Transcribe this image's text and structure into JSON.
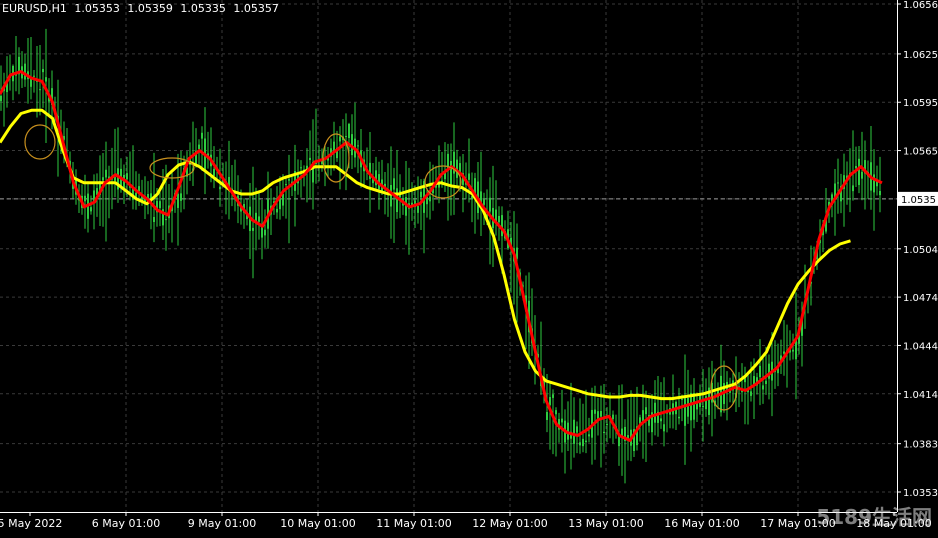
{
  "header": {
    "symbol": "EURUSD,H1",
    "open": "1.05353",
    "high": "1.05359",
    "low": "1.05335",
    "close": "1.05357"
  },
  "watermark": "5189生活网",
  "colors": {
    "background": "#000000",
    "grid": "#3a3a3a",
    "candle": "#2ecc40",
    "ma_fast": "#ff0000",
    "ma_slow": "#ffff00",
    "circle": "#c8901e",
    "axis_text": "#ffffff",
    "price_tag_bg": "#ffffff",
    "price_tag_text": "#000000"
  },
  "chart_data": {
    "type": "line",
    "title": "EURUSD,H1",
    "y_ticks": [
      "1.0656",
      "1.0625",
      "1.0595",
      "1.0565",
      "1.0535",
      "1.0504",
      "1.0474",
      "1.0444",
      "1.0414",
      "1.0383",
      "1.0353"
    ],
    "ylim": [
      1.0347,
      1.066
    ],
    "x_ticks": [
      "5 May 2022",
      "6 May 01:00",
      "9 May 01:00",
      "10 May 01:00",
      "11 May 01:00",
      "12 May 01:00",
      "13 May 01:00",
      "16 May 01:00",
      "17 May 01:00",
      "18 May 01:00"
    ],
    "current_price": "1.0535",
    "grid": true,
    "series": [
      {
        "color": "#ff0000",
        "values": [
          1.06,
          1.0612,
          1.0614,
          1.061,
          1.0608,
          1.0595,
          1.057,
          1.0545,
          1.053,
          1.0533,
          1.0545,
          1.055,
          1.0546,
          1.054,
          1.0535,
          1.0528,
          1.0525,
          1.0542,
          1.056,
          1.0565,
          1.056,
          1.055,
          1.054,
          1.053,
          1.0522,
          1.0518,
          1.053,
          1.054,
          1.0545,
          1.055,
          1.0558,
          1.056,
          1.0565,
          1.057,
          1.0565,
          1.0552,
          1.0545,
          1.054,
          1.0535,
          1.053,
          1.0532,
          1.054,
          1.055,
          1.0555,
          1.055,
          1.054,
          1.053,
          1.0522,
          1.0515,
          1.05,
          1.047,
          1.044,
          1.041,
          1.0395,
          1.039,
          1.0388,
          1.0392,
          1.0398,
          1.04,
          1.0388,
          1.0385,
          1.0395,
          1.04,
          1.0402,
          1.0404,
          1.0406,
          1.0408,
          1.041,
          1.0412,
          1.0415,
          1.0418,
          1.0416,
          1.042,
          1.0425,
          1.043,
          1.044,
          1.045,
          1.048,
          1.051,
          1.053,
          1.054,
          1.055,
          1.0555,
          1.0548,
          1.0545
        ]
      },
      {
        "color": "#ffff00",
        "values": [
          1.057,
          1.058,
          1.0588,
          1.059,
          1.059,
          1.0585,
          1.0565,
          1.0548,
          1.0545,
          1.0545,
          1.0545,
          1.0545,
          1.054,
          1.0535,
          1.0532,
          1.0538,
          1.055,
          1.0556,
          1.0558,
          1.0555,
          1.055,
          1.0545,
          1.054,
          1.0538,
          1.0538,
          1.054,
          1.0545,
          1.0548,
          1.055,
          1.0552,
          1.0555,
          1.0555,
          1.0555,
          1.055,
          1.0545,
          1.0542,
          1.054,
          1.0538,
          1.0538,
          1.054,
          1.0542,
          1.0544,
          1.0545,
          1.0543,
          1.0542,
          1.0538,
          1.0528,
          1.0512,
          1.0488,
          1.046,
          1.044,
          1.0428,
          1.0422,
          1.042,
          1.0418,
          1.0416,
          1.0414,
          1.0413,
          1.0412,
          1.0412,
          1.0413,
          1.0413,
          1.0412,
          1.0411,
          1.0411,
          1.0412,
          1.0413,
          1.0414,
          1.0416,
          1.0418,
          1.042,
          1.0425,
          1.0432,
          1.044,
          1.0455,
          1.047,
          1.0482,
          1.049,
          1.0497,
          1.0503,
          1.0507,
          1.0509
        ]
      }
    ]
  }
}
